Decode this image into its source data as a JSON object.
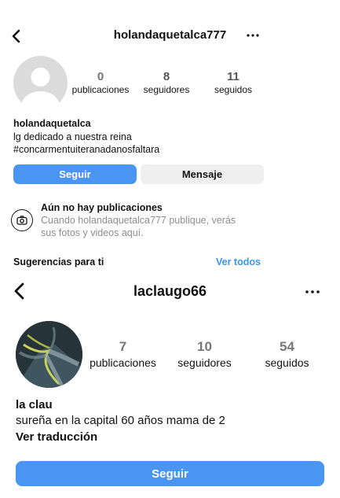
{
  "top_profile": {
    "username": "holandaquetalca777",
    "stats": [
      {
        "value": "0",
        "label": "publicaciones"
      },
      {
        "value": "8",
        "label": "seguidores"
      },
      {
        "value": "11",
        "label": "seguidos"
      }
    ],
    "display_name": "holandaquetalca",
    "bio_lines": [
      "lg dedicado a nuestra reina",
      "#concarmentuiteranadanosfaltara"
    ],
    "follow_label": "Seguir",
    "message_label": "Mensaje",
    "empty_title": "Aún no hay publicaciones",
    "empty_text_1": "Cuando holandaquetalca777 publique, verás",
    "empty_text_2": "sus fotos y videos aquí.",
    "suggestions_label": "Sugerencias para ti",
    "see_all_label": "Ver todos"
  },
  "bottom_profile": {
    "username": "laclaugo66",
    "stats": [
      {
        "value": "7",
        "label": "publicaciones"
      },
      {
        "value": "10",
        "label": "seguidores"
      },
      {
        "value": "54",
        "label": "seguidos"
      }
    ],
    "display_name": "la clau",
    "bio": "sureña en la capital 60 años mama de 2",
    "translate_label": "Ver traducción",
    "follow_label": "Seguir"
  },
  "colors": {
    "accent": "#4a95f2",
    "link": "#3897f0",
    "button_gray": "#efefef"
  },
  "icons": [
    "back-arrow-icon",
    "more-options-icon",
    "camera-icon",
    "default-avatar-icon"
  ]
}
